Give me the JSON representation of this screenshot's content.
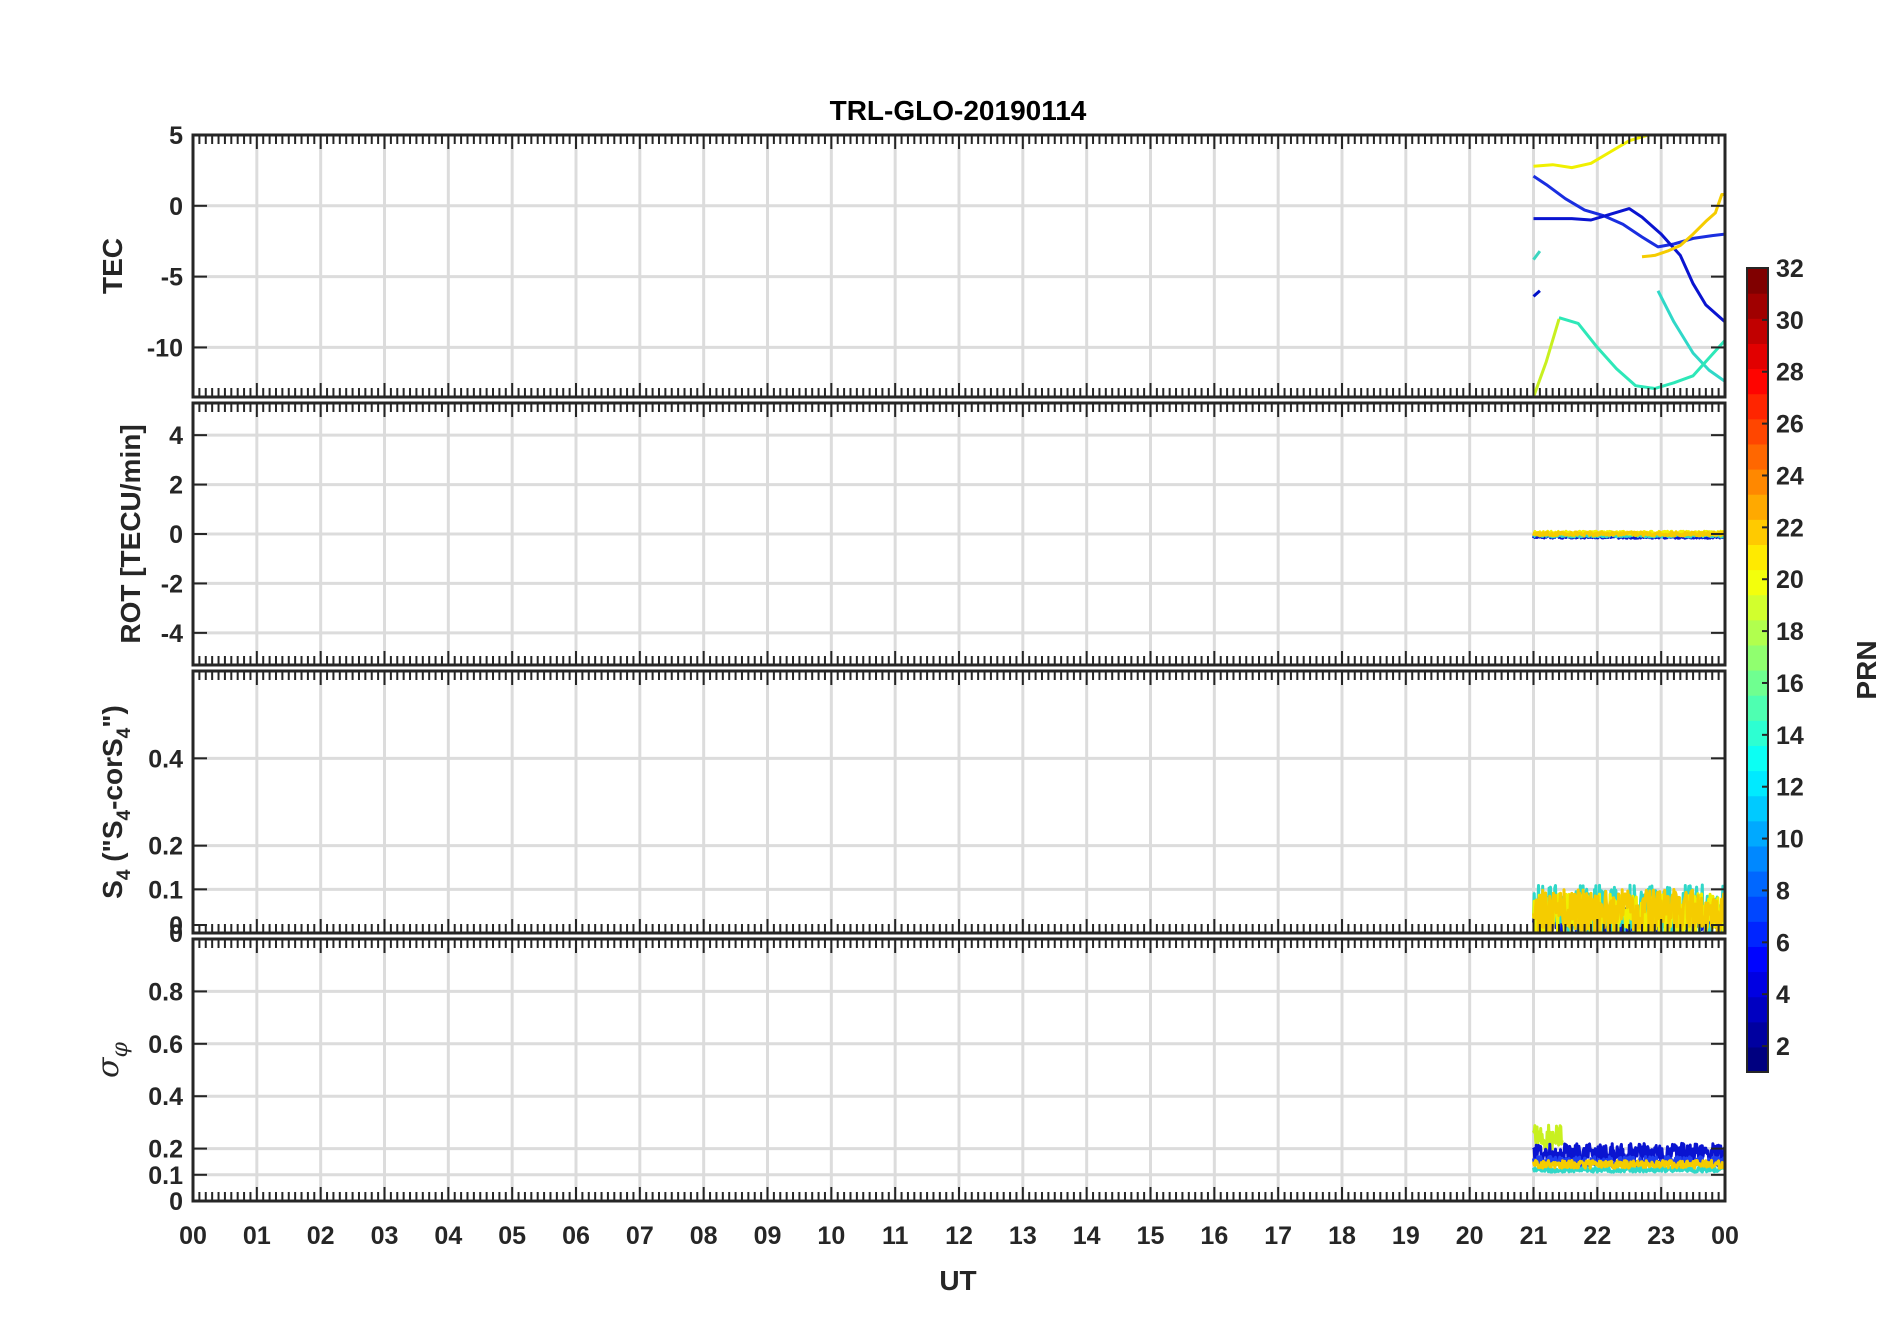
{
  "chart_data": {
    "type": "line",
    "title": "TRL-GLO-20190114",
    "xlabel": "UT",
    "x_tick_labels": [
      "00",
      "01",
      "02",
      "03",
      "04",
      "05",
      "06",
      "07",
      "08",
      "09",
      "10",
      "11",
      "12",
      "13",
      "14",
      "15",
      "16",
      "17",
      "18",
      "19",
      "20",
      "21",
      "22",
      "23",
      "00"
    ],
    "xlim": [
      0,
      24
    ],
    "grid": true,
    "colorbar": {
      "label": "PRN",
      "limits": [
        1,
        32
      ],
      "ticks": [
        2,
        4,
        6,
        8,
        10,
        12,
        14,
        16,
        18,
        20,
        22,
        24,
        26,
        28,
        30,
        32
      ],
      "tick_labels": [
        "2",
        "4",
        "6",
        "8",
        "10",
        "12",
        "14",
        "16",
        "18",
        "20",
        "22",
        "24",
        "26",
        "28",
        "30",
        "32"
      ],
      "colormap": "jet"
    },
    "panels": [
      {
        "id": "tec",
        "ylabel": "TEC",
        "ylim": [
          -13.5,
          5
        ],
        "yticks": [
          5,
          0,
          -5,
          -10
        ],
        "ytick_labels": [
          "5",
          "0",
          "-5",
          "-10"
        ],
        "series": [
          {
            "prn": 19,
            "color": "#f0f000",
            "points": [
              [
                21.0,
                2.8
              ],
              [
                21.3,
                2.9
              ],
              [
                21.6,
                2.7
              ],
              [
                21.9,
                3.0
              ],
              [
                22.2,
                3.8
              ],
              [
                22.5,
                4.6
              ],
              [
                22.8,
                5.0
              ]
            ]
          },
          {
            "prn": 4,
            "color": "#1a2ee0",
            "points": [
              [
                21.0,
                2.1
              ],
              [
                21.2,
                1.5
              ],
              [
                21.5,
                0.5
              ],
              [
                21.8,
                -0.3
              ],
              [
                22.1,
                -0.7
              ],
              [
                22.4,
                -1.3
              ],
              [
                22.7,
                -2.2
              ],
              [
                22.95,
                -2.9
              ],
              [
                23.2,
                -2.7
              ],
              [
                23.5,
                -2.3
              ],
              [
                23.8,
                -2.1
              ],
              [
                24.0,
                -2.0
              ]
            ]
          },
          {
            "prn": 3,
            "color": "#0a14d0",
            "points": [
              [
                21.0,
                -0.9
              ],
              [
                21.3,
                -0.9
              ],
              [
                21.6,
                -0.9
              ],
              [
                21.9,
                -1.0
              ],
              [
                22.2,
                -0.6
              ],
              [
                22.5,
                -0.2
              ],
              [
                22.7,
                -0.8
              ],
              [
                23.0,
                -2.0
              ],
              [
                23.3,
                -3.5
              ],
              [
                23.5,
                -5.5
              ],
              [
                23.7,
                -7.0
              ],
              [
                24.0,
                -8.2
              ]
            ]
          },
          {
            "prn": 21,
            "color": "#f5cc00",
            "points": [
              [
                22.7,
                -3.6
              ],
              [
                22.9,
                -3.5
              ],
              [
                23.1,
                -3.2
              ],
              [
                23.3,
                -2.8
              ],
              [
                23.5,
                -2.0
              ],
              [
                23.7,
                -1.1
              ],
              [
                23.85,
                -0.5
              ],
              [
                23.95,
                0.8
              ],
              [
                24.0,
                0.8
              ]
            ]
          },
          {
            "prn": 13,
            "color": "#3cd6c0",
            "points": [
              [
                21.0,
                -3.8
              ],
              [
                21.1,
                -3.2
              ]
            ]
          },
          {
            "prn": 12,
            "color": "#30d8c8",
            "points": [
              [
                22.95,
                -6.0
              ],
              [
                23.2,
                -8.2
              ],
              [
                23.5,
                -10.4
              ],
              [
                23.75,
                -11.6
              ],
              [
                24.0,
                -12.4
              ]
            ]
          },
          {
            "prn": 14,
            "color": "#2ee8b8",
            "points": [
              [
                21.4,
                -7.9
              ],
              [
                21.7,
                -8.3
              ],
              [
                22.0,
                -10.0
              ],
              [
                22.3,
                -11.5
              ],
              [
                22.6,
                -12.7
              ],
              [
                22.9,
                -12.9
              ],
              [
                23.2,
                -12.5
              ],
              [
                23.5,
                -12.0
              ],
              [
                23.8,
                -10.5
              ],
              [
                24.0,
                -9.5
              ]
            ]
          },
          {
            "prn": 18,
            "color": "#c8f020",
            "points": [
              [
                21.0,
                -13.5
              ],
              [
                21.2,
                -11.0
              ],
              [
                21.4,
                -8.0
              ]
            ]
          },
          {
            "prn": 2,
            "color": "#0010c8",
            "points": [
              [
                21.0,
                -6.4
              ],
              [
                21.1,
                -6.0
              ]
            ]
          }
        ]
      },
      {
        "id": "rot",
        "ylabel": "ROT [TECU/min]",
        "ylim": [
          -5.3,
          5.3
        ],
        "yticks": [
          4,
          2,
          0,
          -2,
          -4
        ],
        "ytick_labels": [
          "4",
          "2",
          "0",
          "-2",
          "-4"
        ],
        "series": [
          {
            "prn": 3,
            "color": "#0a14d0",
            "base": -0.12,
            "amp": 0.05,
            "x0": 21.0,
            "x1": 24.0
          },
          {
            "prn": 12,
            "color": "#30d8c8",
            "base": -0.05,
            "amp": 0.07,
            "x0": 21.0,
            "x1": 24.0
          },
          {
            "prn": 19,
            "color": "#f0f000",
            "base": 0.05,
            "amp": 0.06,
            "x0": 21.0,
            "x1": 24.0
          },
          {
            "prn": 21,
            "color": "#f5cc00",
            "base": 0.0,
            "amp": 0.08,
            "x0": 21.0,
            "x1": 24.0
          }
        ]
      },
      {
        "id": "s4",
        "ylabel_parts": [
          "S",
          "4",
          " (\"S",
          "4",
          "-corS",
          "4",
          "\")"
        ],
        "ylim": [
          0,
          0.6
        ],
        "yticks": [
          0.4,
          0.2,
          0.1,
          0,
          0
        ],
        "ytick_labels": [
          "0.4",
          "0.2",
          "0.1",
          "0",
          "0"
        ],
        "series": [
          {
            "prn": 3,
            "color": "#0a14d0",
            "base": 0.03,
            "amp": 0.03,
            "x0": 21.0,
            "x1": 24.0
          },
          {
            "prn": 12,
            "color": "#30d8c8",
            "base": 0.05,
            "amp": 0.06,
            "x0": 21.0,
            "x1": 24.0
          },
          {
            "prn": 19,
            "color": "#f0f000",
            "base": 0.04,
            "amp": 0.05,
            "x0": 21.0,
            "x1": 24.0
          },
          {
            "prn": 21,
            "color": "#f5cc00",
            "base": 0.05,
            "amp": 0.05,
            "x0": 21.0,
            "x1": 24.0
          }
        ]
      },
      {
        "id": "sigma_phi",
        "ylabel_greek": [
          "σ",
          "φ"
        ],
        "ylim": [
          0,
          1.0
        ],
        "yticks": [
          0.8,
          0.6,
          0.4,
          0.2,
          0.1,
          0
        ],
        "ytick_labels": [
          "0.8",
          "0.6",
          "0.4",
          "0.2",
          "0.1",
          "0"
        ],
        "series": [
          {
            "prn": 18,
            "color": "#c8f020",
            "base": 0.24,
            "amp": 0.05,
            "x0": 21.0,
            "x1": 21.45
          },
          {
            "prn": 3,
            "color": "#0a14d0",
            "base": 0.18,
            "amp": 0.04,
            "x0": 21.0,
            "x1": 24.0
          },
          {
            "prn": 6,
            "color": "#2040f0",
            "base": 0.15,
            "amp": 0.02,
            "x0": 21.0,
            "x1": 24.0
          },
          {
            "prn": 12,
            "color": "#30d8c8",
            "base": 0.12,
            "amp": 0.01,
            "x0": 21.0,
            "x1": 24.0
          },
          {
            "prn": 21,
            "color": "#f5cc00",
            "base": 0.14,
            "amp": 0.015,
            "x0": 21.0,
            "x1": 24.0
          }
        ]
      }
    ]
  }
}
